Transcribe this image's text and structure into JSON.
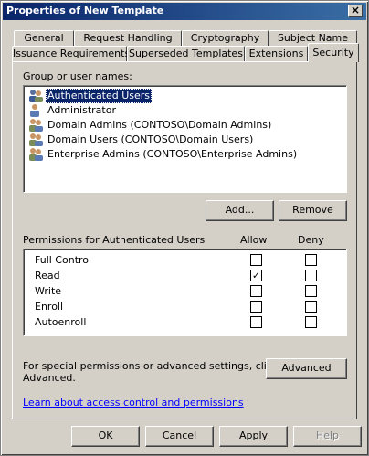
{
  "window": {
    "title": "Properties of New Template",
    "close_glyph": "×"
  },
  "tabs_back": [
    {
      "label": "General"
    },
    {
      "label": "Request Handling"
    },
    {
      "label": "Cryptography"
    },
    {
      "label": "Subject Name"
    }
  ],
  "tabs_front": [
    {
      "label": "Issuance Requirements"
    },
    {
      "label": "Superseded Templates"
    },
    {
      "label": "Extensions"
    },
    {
      "label": "Security"
    }
  ],
  "active_tab": "Security",
  "groups": {
    "label": "Group or user names:",
    "items": [
      {
        "name": "Authenticated Users",
        "icon": "user-group-icon",
        "selected": true
      },
      {
        "name": "Administrator",
        "icon": "user-icon",
        "selected": false
      },
      {
        "name": "Domain Admins (CONTOSO\\Domain Admins)",
        "icon": "user-group-icon",
        "selected": false
      },
      {
        "name": "Domain Users (CONTOSO\\Domain Users)",
        "icon": "user-group-icon",
        "selected": false
      },
      {
        "name": "Enterprise Admins (CONTOSO\\Enterprise Admins)",
        "icon": "user-group-icon",
        "selected": false
      }
    ]
  },
  "buttons": {
    "add": "Add...",
    "remove": "Remove",
    "advanced": "Advanced"
  },
  "permissions": {
    "label": "Permissions for Authenticated Users",
    "allow_header": "Allow",
    "deny_header": "Deny",
    "check_glyph": "✓",
    "rows": [
      {
        "name": "Full Control",
        "allow": false,
        "deny": false
      },
      {
        "name": "Read",
        "allow": true,
        "deny": false
      },
      {
        "name": "Write",
        "allow": false,
        "deny": false
      },
      {
        "name": "Enroll",
        "allow": false,
        "deny": false
      },
      {
        "name": "Autoenroll",
        "allow": false,
        "deny": false
      }
    ]
  },
  "special": {
    "line1": "For special permissions or advanced settings, click",
    "line2": "Advanced."
  },
  "learn_link": "Learn about access control and permissions",
  "footer": {
    "ok": "OK",
    "cancel": "Cancel",
    "apply": "Apply",
    "help": "Help"
  }
}
